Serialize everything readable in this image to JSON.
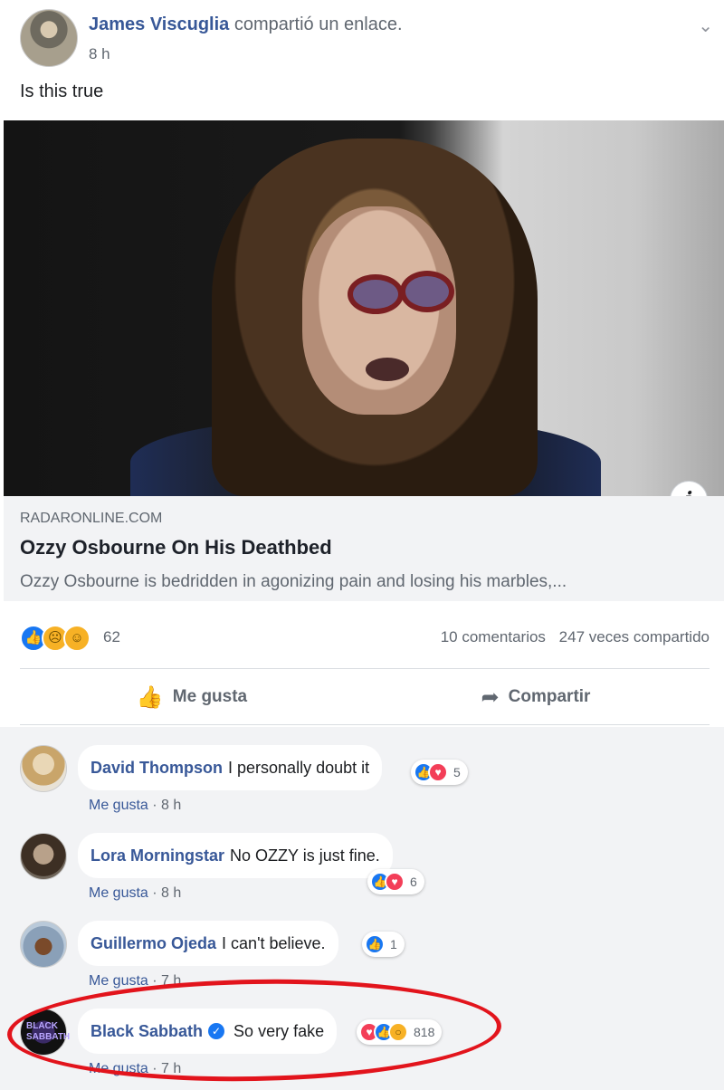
{
  "post": {
    "author": "James Viscuglia",
    "action": "compartió un enlace.",
    "time": "8 h",
    "text": "Is this true"
  },
  "link": {
    "domain": "RADARONLINE.COM",
    "title": "Ozzy Osbourne On His Deathbed",
    "description": "Ozzy Osbourne is bedridden in agonizing pain and losing his marbles,...",
    "info_glyph": "i"
  },
  "stats": {
    "reactions": [
      "like",
      "sad",
      "haha"
    ],
    "reaction_count": "62",
    "comments": "10 comentarios",
    "shares": "247 veces compartido"
  },
  "actions": {
    "like_label": "Me gusta",
    "share_label": "Compartir"
  },
  "comments": [
    {
      "name": "David Thompson",
      "text": "I personally doubt it",
      "reactions": [
        "like",
        "love"
      ],
      "count": "5",
      "like_label": "Me gusta",
      "time": "8 h"
    },
    {
      "name": "Lora Morningstar",
      "text": "No OZZY is just fine.",
      "reactions": [
        "like",
        "love"
      ],
      "count": "6",
      "like_label": "Me gusta",
      "time": "8 h"
    },
    {
      "name": "Guillermo Ojeda",
      "text": "I can't believe.",
      "reactions": [
        "like"
      ],
      "count": "1",
      "like_label": "Me gusta",
      "time": "7 h"
    },
    {
      "name": "Black Sabbath",
      "verified": true,
      "text": "So very fake",
      "reactions": [
        "love",
        "like",
        "wow"
      ],
      "count": "818",
      "like_label": "Me gusta",
      "time": "7 h",
      "avatar_text": "BLACK SABBATH"
    }
  ],
  "colors": {
    "link_blue": "#385898",
    "facebook_blue": "#1877f2",
    "highlight_red": "#e2141c"
  }
}
